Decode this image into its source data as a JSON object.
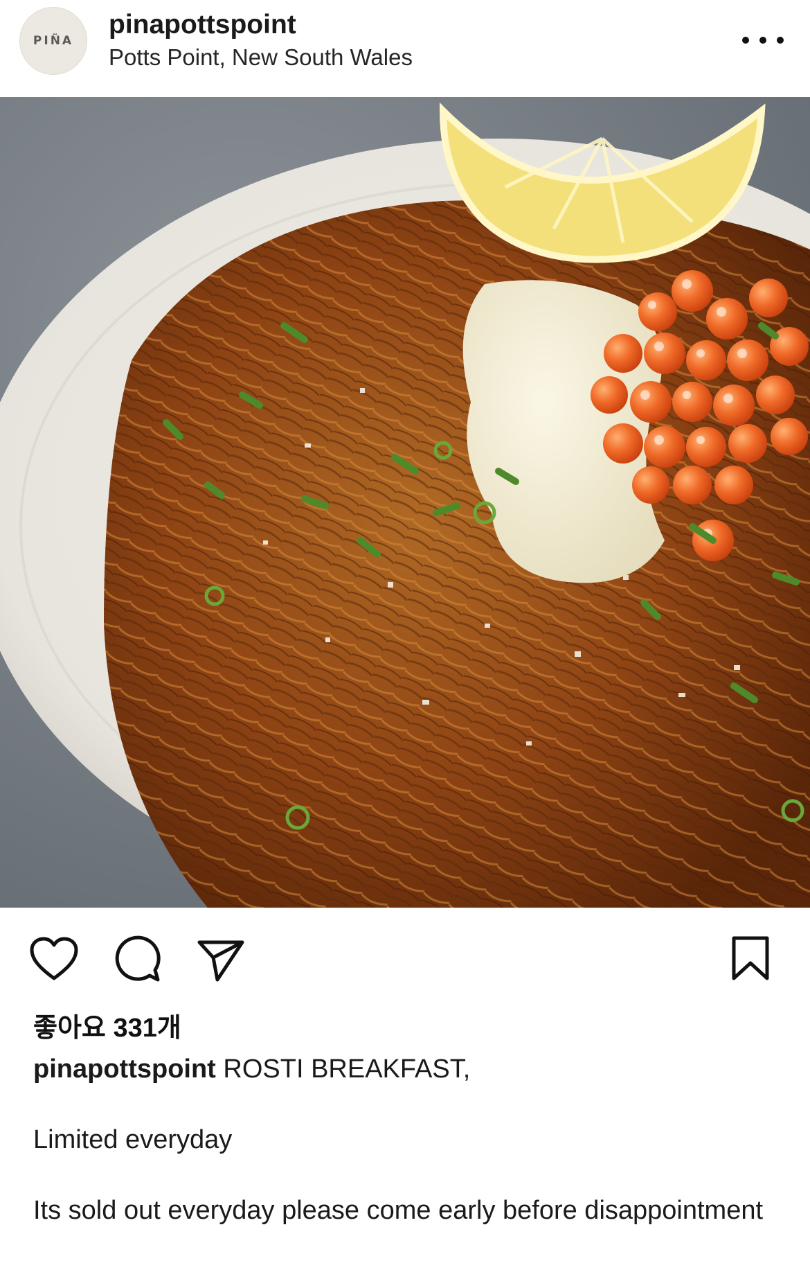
{
  "post": {
    "avatar_text": "PIÑA",
    "username": "pinapottspoint",
    "location": "Potts Point, New South Wales",
    "more_icon": "more-horizontal-icon",
    "photo_subject": "rosti-dish-photo"
  },
  "actions": {
    "like_icon": "heart-icon",
    "comment_icon": "comment-bubble-icon",
    "share_icon": "send-paper-plane-icon",
    "save_icon": "bookmark-icon"
  },
  "likes": {
    "text": "좋아요 331개"
  },
  "caption": {
    "username": "pinapottspoint",
    "line1": "ROSTI BREAKFAST,",
    "line2": "Limited everyday",
    "line3": "Its sold out everyday please come early before disappointment"
  },
  "colors": {
    "text": "#111111",
    "avatar_bg": "#ece9e2",
    "roe": "#e8561f",
    "rosti": "#9a4a14"
  }
}
